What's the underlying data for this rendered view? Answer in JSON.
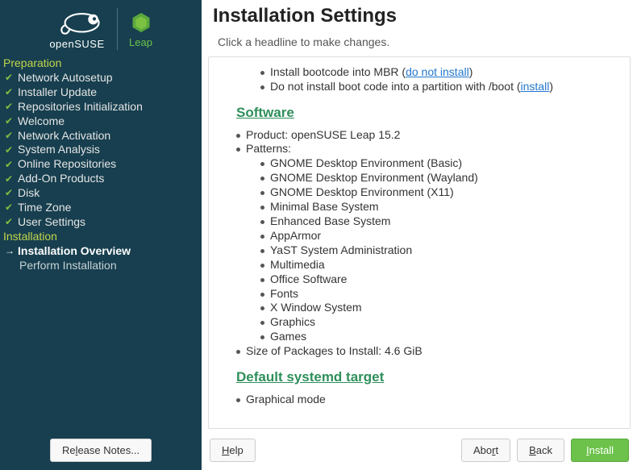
{
  "branding": {
    "suse_label": "openSUSE",
    "leap_label": "Leap"
  },
  "sidebar": {
    "section_prep": "Preparation",
    "section_install": "Installation",
    "items_prep": [
      "Network Autosetup",
      "Installer Update",
      "Repositories Initialization",
      "Welcome",
      "Network Activation",
      "System Analysis",
      "Online Repositories",
      "Add-On Products",
      "Disk",
      "Time Zone",
      "User Settings"
    ],
    "item_overview": "Installation Overview",
    "item_perform": "Perform Installation",
    "release_notes_btn": "Release Notes..."
  },
  "header": {
    "title": "Installation Settings",
    "subtitle": "Click a headline to make changes."
  },
  "content": {
    "boot1_pre": "Install bootcode into MBR (",
    "boot1_link": "do not install",
    "boot1_post": ")",
    "boot2_pre": "Do not install boot code into a partition with /boot (",
    "boot2_link": "install",
    "boot2_post": ")",
    "software_hdr": "Software",
    "product": "Product: openSUSE Leap 15.2",
    "patterns_label": "Patterns:",
    "patterns": [
      "GNOME Desktop Environment (Basic)",
      "GNOME Desktop Environment (Wayland)",
      "GNOME Desktop Environment (X11)",
      "Minimal Base System",
      "Enhanced Base System",
      "AppArmor",
      "YaST System Administration",
      "Multimedia",
      "Office Software",
      "Fonts",
      "X Window System",
      "Graphics",
      "Games"
    ],
    "size": "Size of Packages to Install: 4.6 GiB",
    "systemd_hdr": "Default systemd target",
    "systemd_mode": "Graphical mode"
  },
  "footer": {
    "help": "Help",
    "abort": "Abort",
    "back": "Back",
    "install": "Install"
  }
}
